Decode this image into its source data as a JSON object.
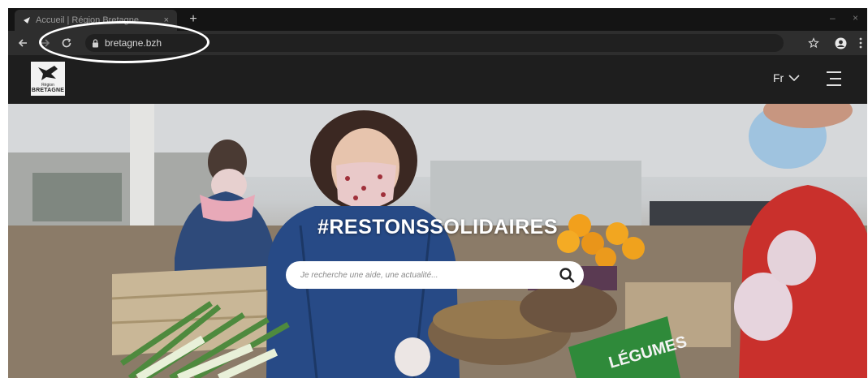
{
  "browser": {
    "tab": {
      "title": "Accueil | Région Bretagne",
      "close_glyph": "×"
    },
    "new_tab_glyph": "+",
    "address": {
      "url": "bretagne.bzh"
    },
    "icons": {
      "back": "arrow-left-icon",
      "forward": "arrow-right-icon",
      "reload": "reload-icon",
      "lock": "lock-icon",
      "bookmark": "star-icon",
      "profile": "account-icon",
      "menu": "kebab-menu-icon"
    }
  },
  "site": {
    "logo": {
      "line1": "Région",
      "line2": "BRETAGNE"
    },
    "language": {
      "selected": "Fr",
      "icon": "chevron-down-icon"
    },
    "menu_icon": "hamburger-icon"
  },
  "hero": {
    "title": "#RESTONSSOLIDAIRES",
    "search": {
      "placeholder": "Je recherche une aide, une actualité...",
      "icon": "search-icon"
    },
    "sign_text": "LÉGUMES"
  },
  "colors": {
    "header_bg": "#1e1e1e",
    "toolbar_bg": "#2e2e2e",
    "tabstrip_bg": "#141414",
    "search_bg": "#ffffff",
    "title_text": "#ffffff",
    "annotation": "#ffffff"
  }
}
